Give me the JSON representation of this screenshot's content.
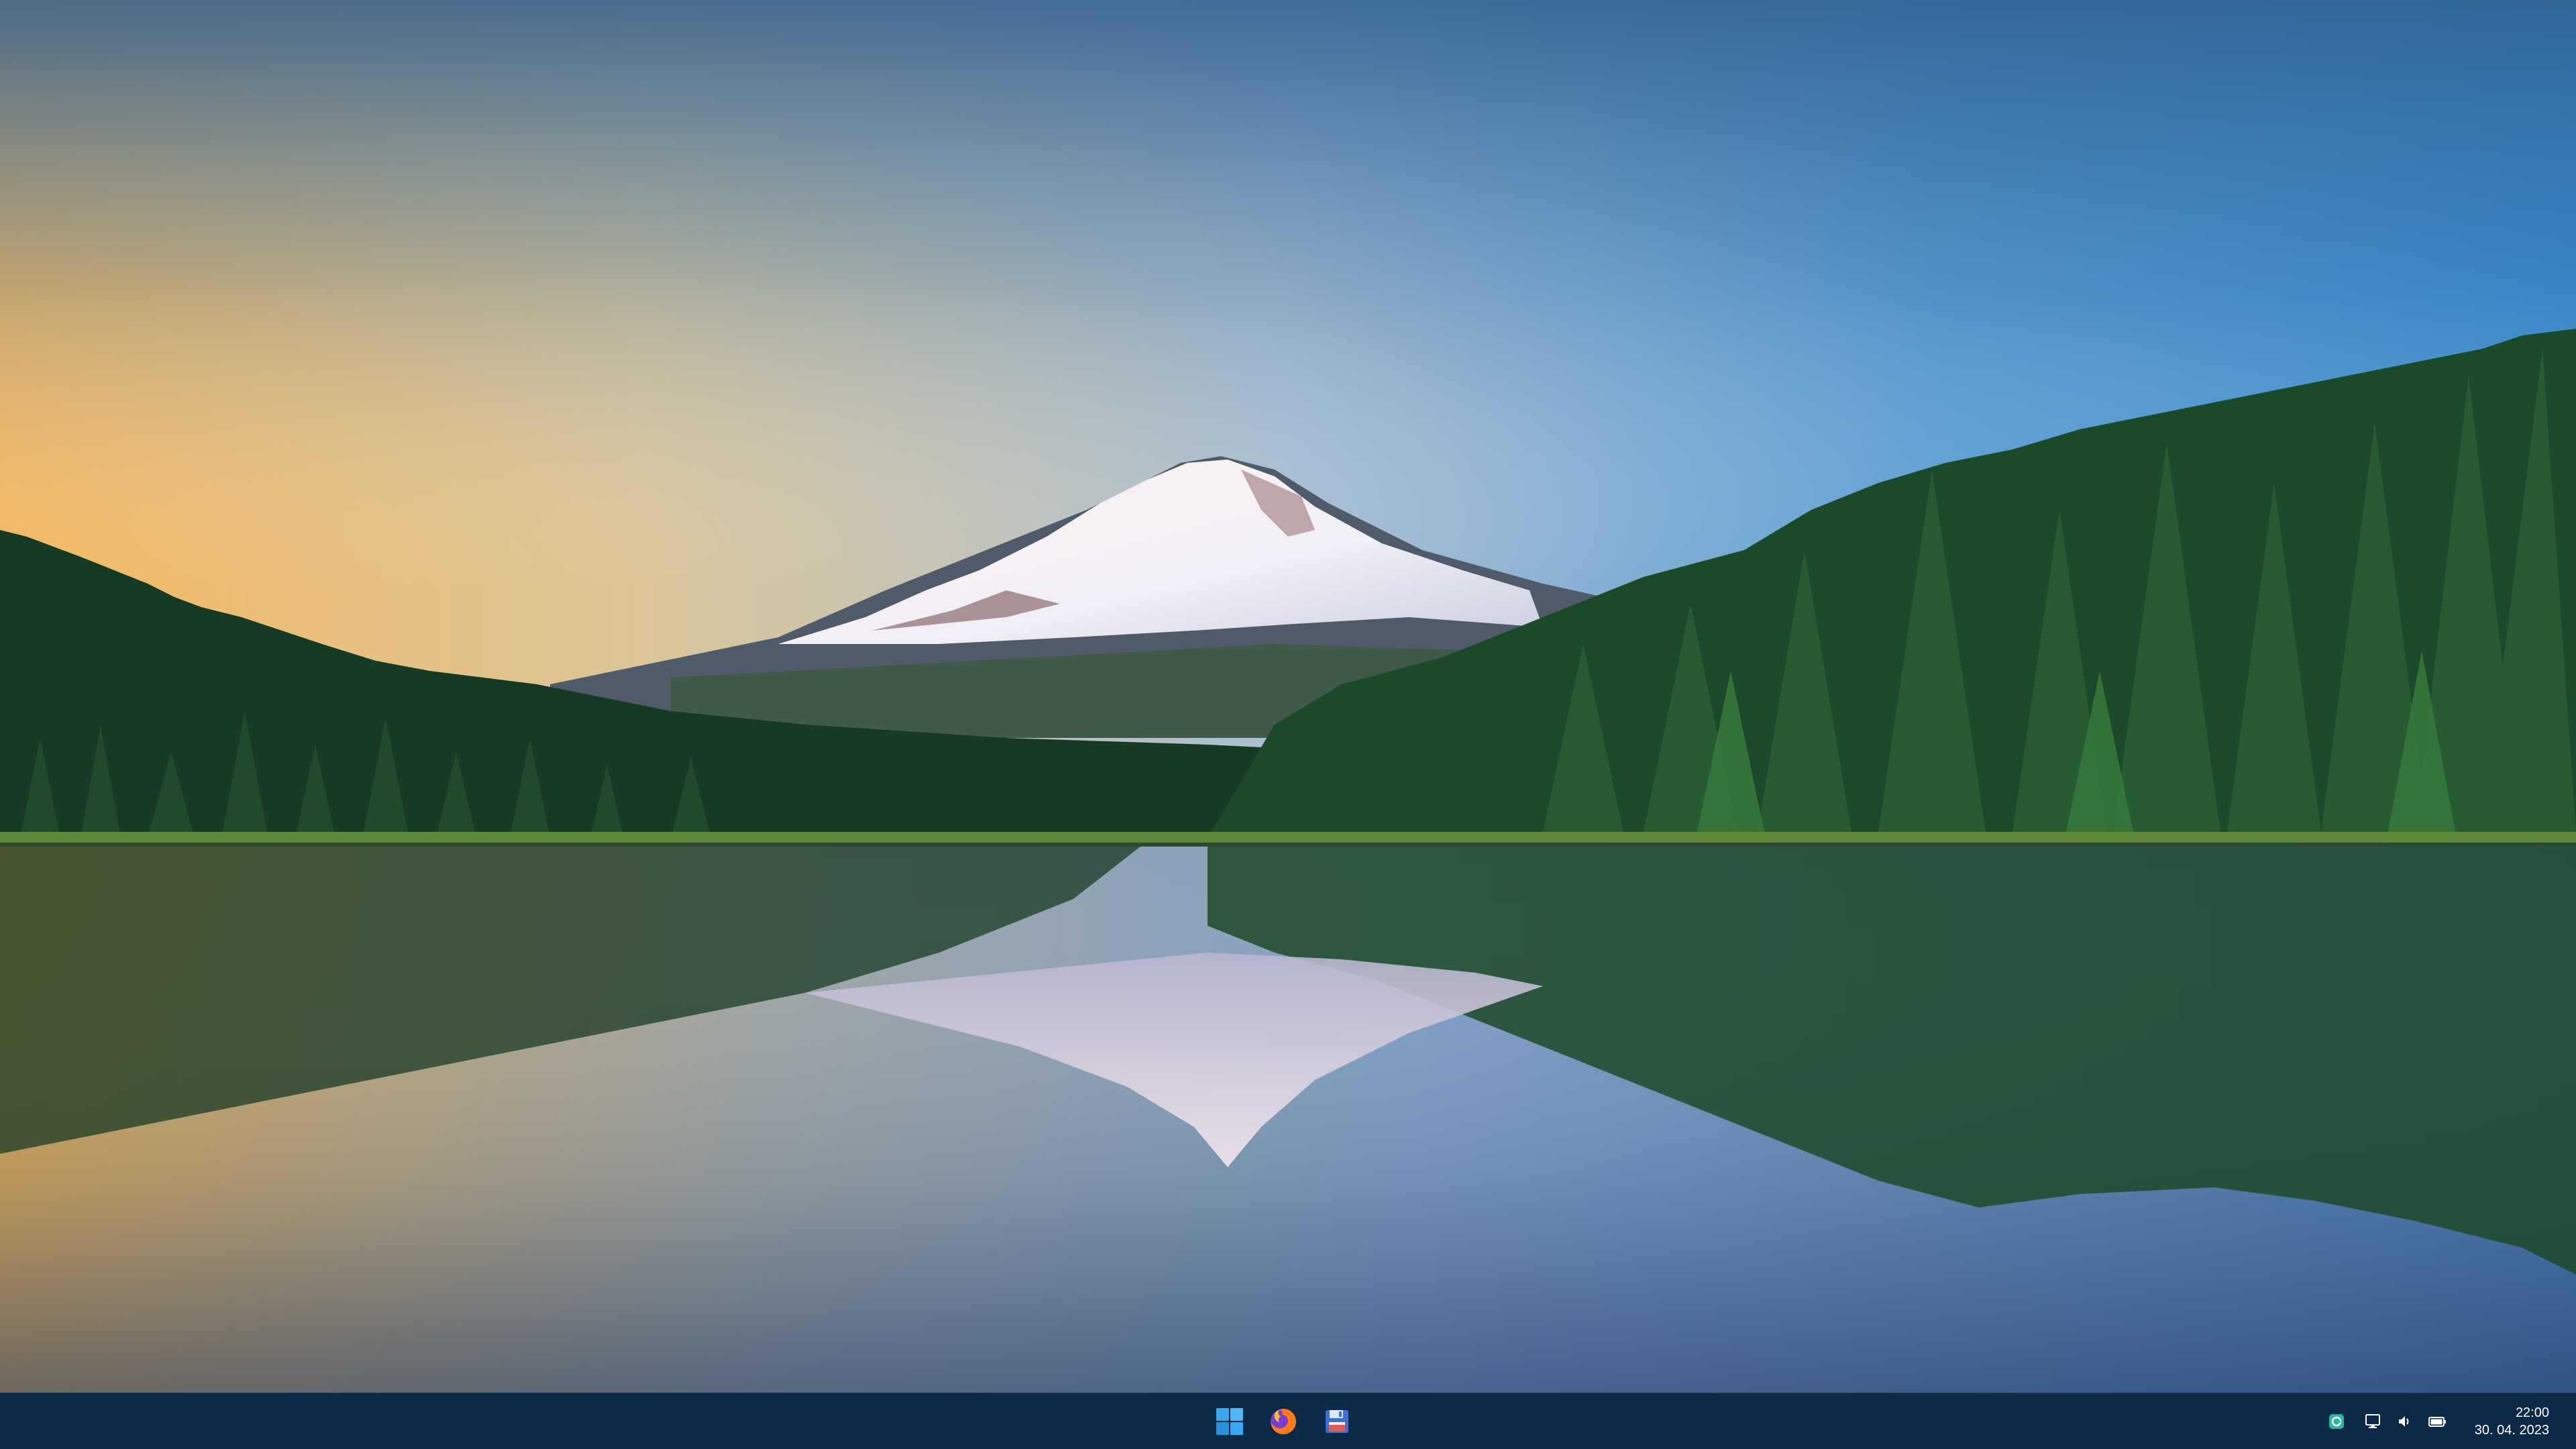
{
  "desktop": {
    "wallpaper_icon": "mountain-lake-landscape"
  },
  "taskbar": {
    "background": "#0c2a48",
    "pinned": [
      {
        "icon": "windows-start-icon"
      },
      {
        "icon": "firefox-icon"
      },
      {
        "icon": "floppy-disk-app-icon"
      }
    ],
    "tray": {
      "icons": [
        "app-tray-icon",
        "network-icon",
        "volume-icon",
        "battery-icon"
      ],
      "time": "22:00",
      "date": "30. 04. 2023"
    }
  },
  "colors": {
    "accent_start": "#3aa7f0",
    "taskbar_text": "#ffffff"
  }
}
